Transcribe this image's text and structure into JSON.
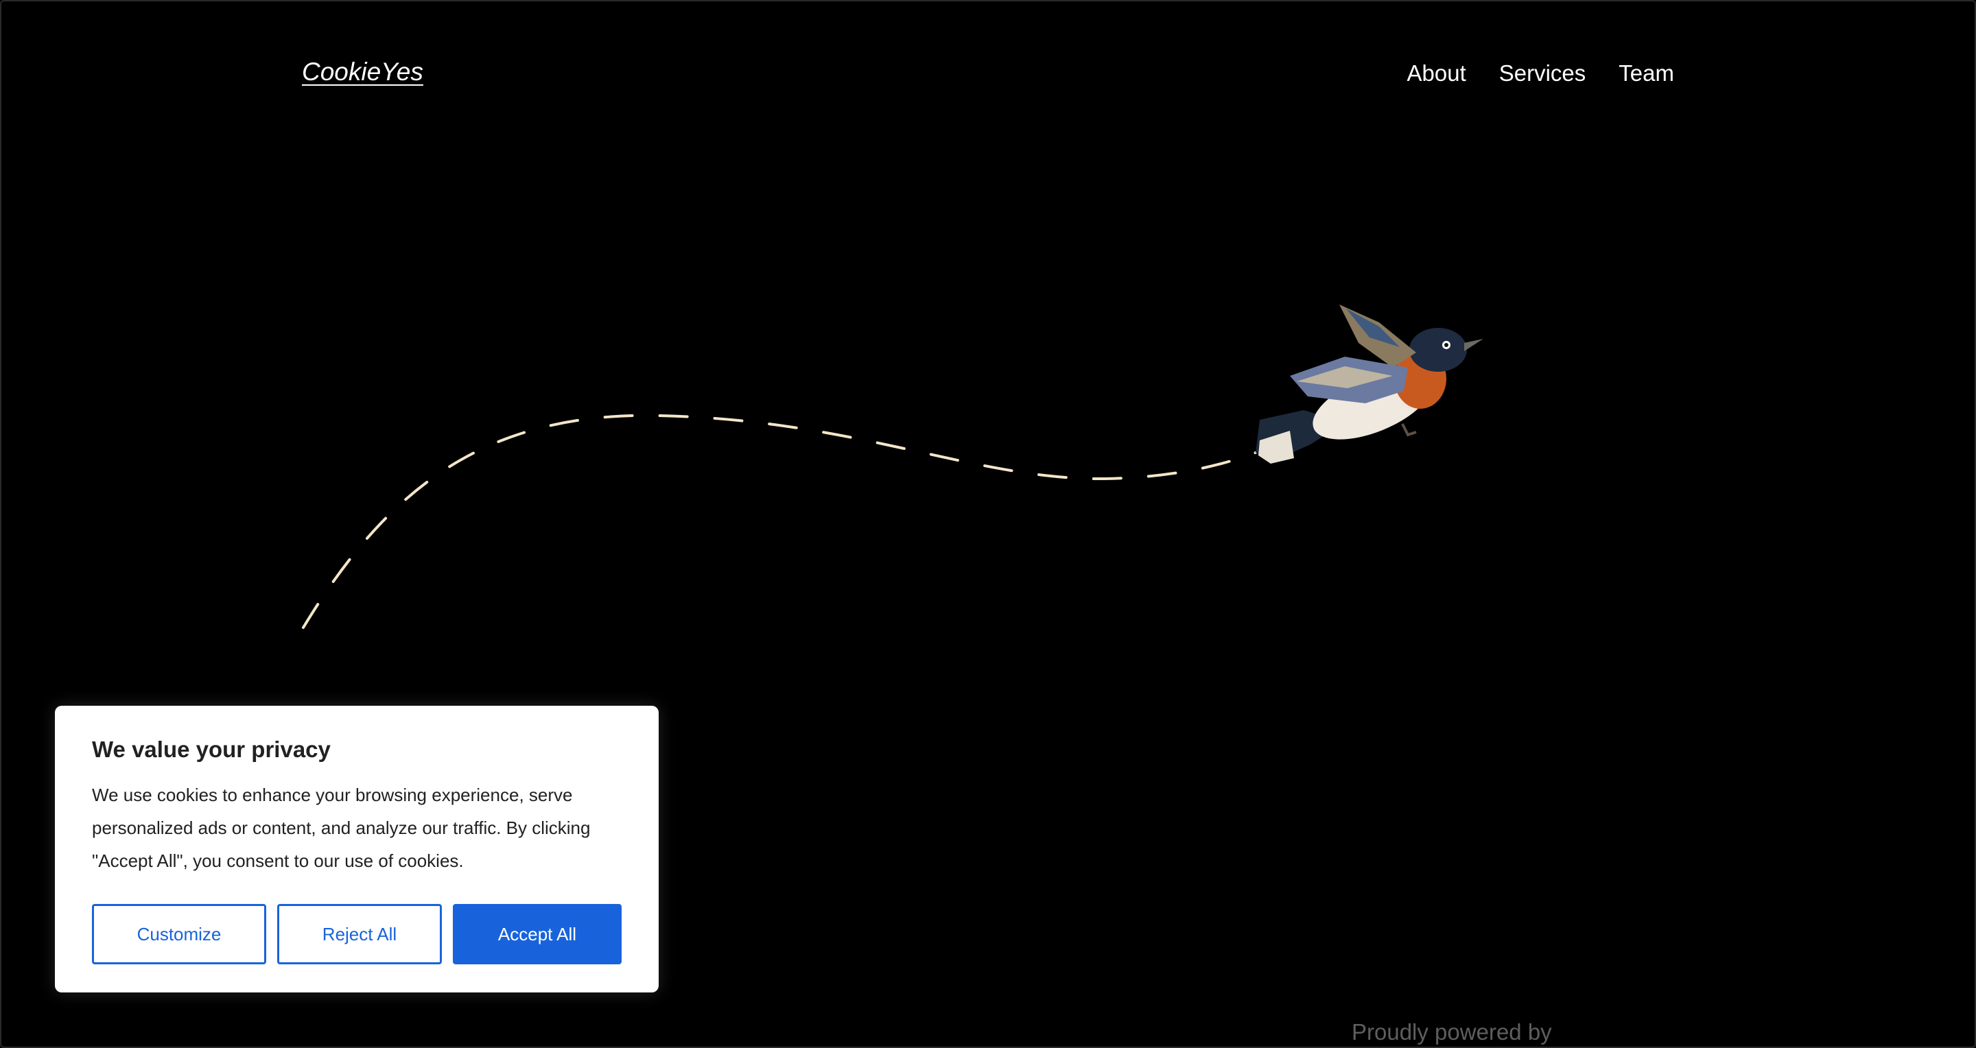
{
  "header": {
    "site_title": "CookieYes",
    "nav": [
      {
        "label": "About"
      },
      {
        "label": "Services"
      },
      {
        "label": "Team"
      }
    ]
  },
  "hero": {
    "image": "flying-bird-illustration",
    "path_style": "dashed-flight-path",
    "path_color": "#f3e6c8"
  },
  "footer": {
    "text": "Proudly powered by"
  },
  "cookie_banner": {
    "title": "We value your privacy",
    "description": "We use cookies to enhance your browsing experience, serve personalized ads or content, and analyze our traffic. By clicking \"Accept All\", you consent to our use of cookies.",
    "buttons": {
      "customize": "Customize",
      "reject": "Reject All",
      "accept": "Accept All"
    },
    "accent_color": "#1863dc"
  }
}
